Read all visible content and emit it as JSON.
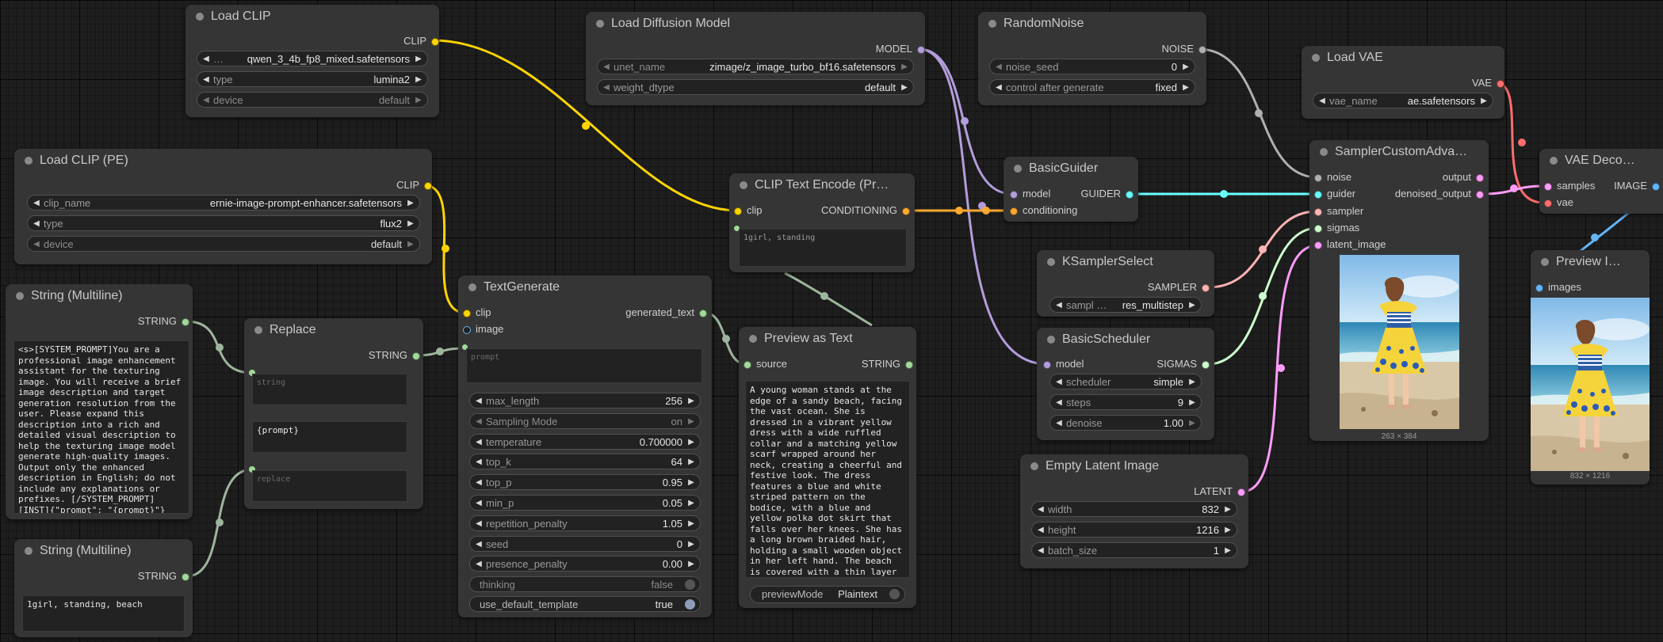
{
  "colors": {
    "clip": "#ffd500",
    "model": "#b39ddb",
    "noise": "#b0b0b0",
    "vae": "#ff6e6e",
    "guider": "#66ffff",
    "sampler": "#ffb3b3",
    "sigmas": "#cdffcd",
    "latent": "#ff9cf9",
    "image": "#64b5f6",
    "conditioning": "#ffa931",
    "string": "#a1d99b",
    "string_link": "#9db59d"
  },
  "nodes": {
    "load_clip": {
      "title": "Load CLIP",
      "out_clip": "CLIP",
      "w_clip_name_ellipsis": "…",
      "w_clip_name_value": "qwen_3_4b_fp8_mixed.safetensors",
      "w_type_label": "type",
      "w_type_value": "lumina2",
      "w_device_label": "device",
      "w_device_value": "default"
    },
    "load_diffusion": {
      "title": "Load Diffusion Model",
      "out_model": "MODEL",
      "w_unet_label": "unet_name",
      "w_unet_value": "zimage/z_image_turbo_bf16.safetensors",
      "w_dtype_label": "weight_dtype",
      "w_dtype_value": "default"
    },
    "random_noise": {
      "title": "RandomNoise",
      "out_noise": "NOISE",
      "w_seed_label": "noise_seed",
      "w_seed_value": "0",
      "w_control_label": "control after generate",
      "w_control_value": "fixed"
    },
    "load_vae": {
      "title": "Load VAE",
      "out_vae": "VAE",
      "w_vae_label": "vae_name",
      "w_vae_value": "ae.safetensors"
    },
    "load_clip_pe": {
      "title": "Load CLIP (PE)",
      "out_clip": "CLIP",
      "w_clip_name_label": "clip_name",
      "w_clip_name_value": "ernie-image-prompt-enhancer.safetensors",
      "w_type_label": "type",
      "w_type_value": "flux2",
      "w_device_label": "device",
      "w_device_value": "default"
    },
    "clip_text_encode": {
      "title": "CLIP Text Encode (Pr…",
      "in_clip": "clip",
      "out_conditioning": "CONDITIONING",
      "text": "1girl, standing"
    },
    "basic_guider": {
      "title": "BasicGuider",
      "in_model": "model",
      "in_conditioning": "conditioning",
      "out_guider": "GUIDER"
    },
    "sampler_custom": {
      "title": "SamplerCustomAdva…",
      "in_noise": "noise",
      "in_guider": "guider",
      "in_sampler": "sampler",
      "in_sigmas": "sigmas",
      "in_latent": "latent_image",
      "out_output": "output",
      "out_denoised": "denoised_output",
      "image_size": "263 × 384"
    },
    "vae_decode": {
      "title": "VAE Deco…",
      "in_samples": "samples",
      "in_vae": "vae",
      "out_image": "IMAGE"
    },
    "preview_image": {
      "title": "Preview I…",
      "in_images": "images",
      "image_size": "832 × 1216"
    },
    "string_multiline_1": {
      "title": "String (Multiline)",
      "out_string": "STRING",
      "text": "<s>[SYSTEM_PROMPT]You are a professional image enhancement assistant for the texturing image. You will receive a brief image description and target generation resolution from the user. Please expand this description into a rich and detailed visual description to help the texturing image model generate high-quality images. Output only the enhanced description in English; do not include any explanations or prefixes. [/SYSTEM_PROMPT][INST]{\"prompt\": \"{prompt}\"}[/INST]"
    },
    "string_multiline_2": {
      "title": "String (Multiline)",
      "out_string": "STRING",
      "text": "1girl, standing, beach"
    },
    "replace": {
      "title": "Replace",
      "out_string": "STRING",
      "ph_string": "string",
      "find_text": "{prompt}",
      "ph_replace": "replace"
    },
    "text_generate": {
      "title": "TextGenerate",
      "in_clip": "clip",
      "in_image": "image",
      "out_text": "generated_text",
      "ph_prompt": "prompt",
      "widgets": [
        {
          "label": "max_length",
          "value": "256"
        },
        {
          "label": "Sampling Mode",
          "value": "on"
        },
        {
          "label": "temperature",
          "value": "0.700000"
        },
        {
          "label": "top_k",
          "value": "64"
        },
        {
          "label": "top_p",
          "value": "0.95"
        },
        {
          "label": "min_p",
          "value": "0.05"
        },
        {
          "label": "repetition_penalty",
          "value": "1.05"
        },
        {
          "label": "seed",
          "value": "0"
        },
        {
          "label": "presence_penalty",
          "value": "0.00"
        }
      ],
      "w_thinking_label": "thinking",
      "w_thinking_value": "false",
      "w_template_label": "use_default_template",
      "w_template_value": "true"
    },
    "preview_text": {
      "title": "Preview as Text",
      "in_source": "source",
      "out_string": "STRING",
      "text": "A young woman stands at the edge of a sandy beach, facing the vast ocean. She is dressed in a vibrant yellow dress with a wide ruffled collar and a matching yellow scarf wrapped around her neck, creating a cheerful and festive look. The dress features a blue and white striped pattern on the bodice, with a blue and yellow polka dot skirt that falls over her knees. She has a long brown braided hair, holding a small wooden object in her left hand. The beach is covered with a thin layer of white sand, scattered with",
      "mode_label": "previewMode",
      "mode_value": "Plaintext"
    },
    "ksampler_select": {
      "title": "KSamplerSelect",
      "out_sampler": "SAMPLER",
      "w_sampler_label": "sampl …",
      "w_sampler_value": "res_multistep"
    },
    "basic_scheduler": {
      "title": "BasicScheduler",
      "in_model": "model",
      "out_sigmas": "SIGMAS",
      "w_scheduler_label": "scheduler",
      "w_scheduler_value": "simple",
      "w_steps_label": "steps",
      "w_steps_value": "9",
      "w_denoise_label": "denoise",
      "w_denoise_value": "1.00"
    },
    "empty_latent": {
      "title": "Empty Latent Image",
      "out_latent": "LATENT",
      "w_width_label": "width",
      "w_width_value": "832",
      "w_height_label": "height",
      "w_height_value": "1216",
      "w_batch_label": "batch_size",
      "w_batch_value": "1"
    }
  }
}
